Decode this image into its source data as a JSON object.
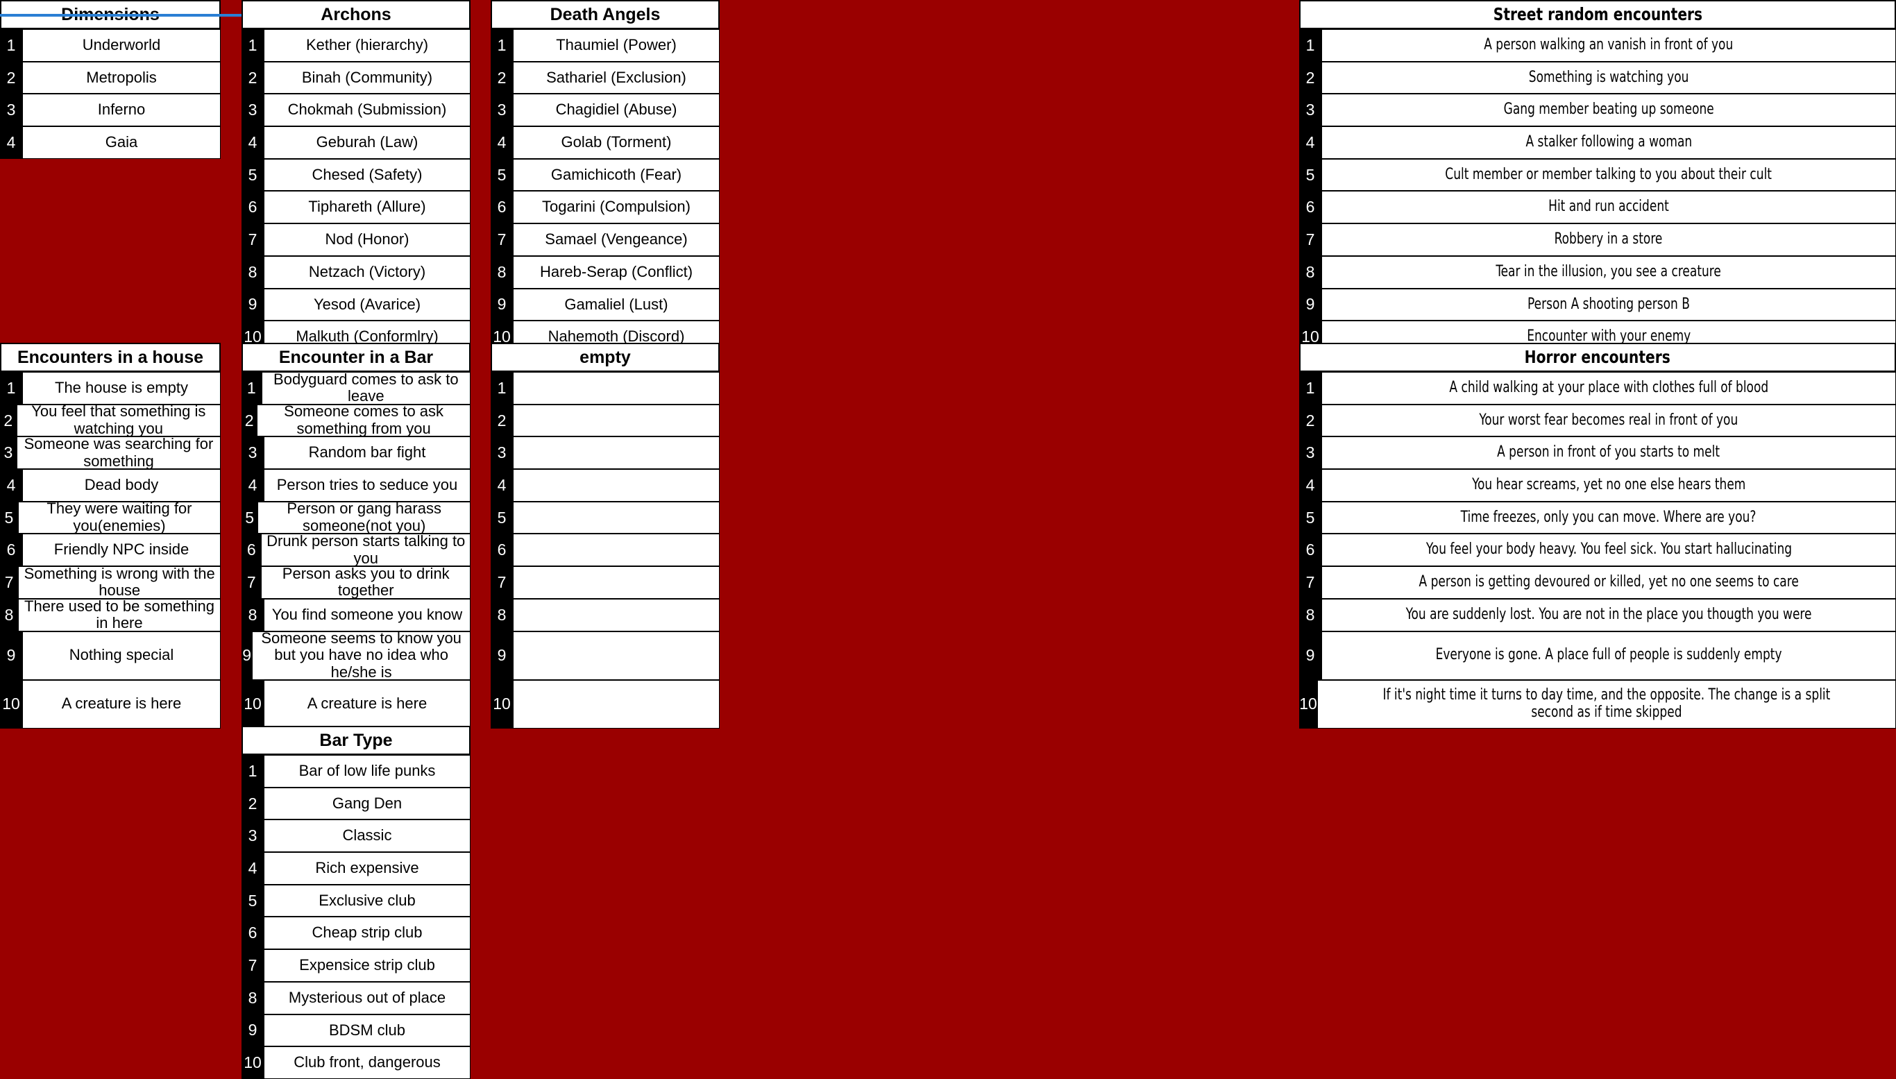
{
  "background_color": "#9a0000",
  "tables": [
    {
      "key": "dimensions",
      "title": "Dimensions",
      "indices": [
        "1",
        "2",
        "3",
        "4"
      ],
      "items": [
        "Underworld",
        "Metropolis",
        "Inferno",
        "Gaia"
      ]
    },
    {
      "key": "archons",
      "title": "Archons",
      "indices": [
        "1",
        "2",
        "3",
        "4",
        "5",
        "6",
        "7",
        "8",
        "9",
        "10"
      ],
      "items": [
        "Kether (hierarchy)",
        "Binah (Community)",
        "Chokmah (Submission)",
        "Geburah (Law)",
        "Chesed (Safety)",
        "Tiphareth (Allure)",
        "Nod (Honor)",
        "Netzach (Victory)",
        "Yesod (Avarice)",
        "Malkuth (Conformlry)"
      ]
    },
    {
      "key": "death_angels",
      "title": "Death Angels",
      "indices": [
        "1",
        "2",
        "3",
        "4",
        "5",
        "6",
        "7",
        "8",
        "9",
        "10"
      ],
      "items": [
        "Thaumiel (Power)",
        "Sathariel (Exclusion)",
        "Chagidiel (Abuse)",
        "Golab (Torment)",
        "Gamichicoth (Fear)",
        "Togarini (Compulsion)",
        "Samael (Vengeance)",
        "Hareb-Serap (Conflict)",
        "Gamaliel (Lust)",
        "Nahemoth (Discord)"
      ]
    },
    {
      "key": "street_random_encounters",
      "title": "Street random encounters",
      "indices": [
        "1",
        "2",
        "3",
        "4",
        "5",
        "6",
        "7",
        "8",
        "9",
        "10"
      ],
      "items": [
        "A person walking an vanish in front of you",
        "Something is watching you",
        "Gang member beating up someone",
        "A stalker following a woman",
        "Cult member or member talking to you about their cult",
        "Hit and run accident",
        "Robbery in a store",
        "Tear in the illusion, you see a creature",
        "Person A shooting person B",
        "Encounter with your enemy"
      ]
    },
    {
      "key": "encounters_in_a_house",
      "title": "Encounters in a house",
      "indices": [
        "1",
        "2",
        "3",
        "4",
        "5",
        "6",
        "7",
        "8",
        "9",
        "10"
      ],
      "items": [
        "The house is empty",
        "You feel that something is watching you",
        "Someone was searching for something",
        "Dead body",
        "They were waiting for you(enemies)",
        "Friendly NPC inside",
        "Something is wrong with the house",
        "There used to be something in here",
        "Nothing special",
        "A creature is here"
      ]
    },
    {
      "key": "encounter_in_a_bar",
      "title": "Encounter in a Bar",
      "indices": [
        "1",
        "2",
        "3",
        "4",
        "5",
        "6",
        "7",
        "8",
        "9",
        "10"
      ],
      "items": [
        "Bodyguard comes to ask to leave",
        "Someone comes to ask something from you",
        "Random bar fight",
        "Person tries to seduce you",
        "Person or gang harass someone(not you)",
        "Drunk person starts talking to you",
        "Person asks you to drink together",
        "You find someone you know",
        "Someone seems to know you but you have no idea who he/she is",
        "A creature is here"
      ]
    },
    {
      "key": "empty",
      "title": "empty",
      "indices": [
        "1",
        "2",
        "3",
        "4",
        "5",
        "6",
        "7",
        "8",
        "9",
        "10"
      ],
      "items": [
        "",
        "",
        "",
        "",
        "",
        "",
        "",
        "",
        "",
        ""
      ]
    },
    {
      "key": "horror_encounters",
      "title": "Horror encounters",
      "indices": [
        "1",
        "2",
        "3",
        "4",
        "5",
        "6",
        "7",
        "8",
        "9",
        "10"
      ],
      "items": [
        "A child walking at your place with clothes full of blood",
        "Your worst fear becomes real in front of you",
        "A person in front of you starts to melt",
        "You hear screams, yet no one else hears them",
        "Time freezes, only you can move. Where are you?",
        "You feel your body heavy. You feel sick. You start hallucinating",
        "A person is getting devoured or killed, yet no one seems to care",
        "You are suddenly lost. You are not in the place you thougth you were",
        "Everyone is gone. A place full of people is suddenly empty",
        "If it's night time it turns to day time, and the opposite. The change is a split second as if time skipped"
      ]
    },
    {
      "key": "bar_type",
      "title": "Bar Type",
      "indices": [
        "1",
        "2",
        "3",
        "4",
        "5",
        "6",
        "7",
        "8",
        "9",
        "10"
      ],
      "items": [
        "Bar of low life punks",
        "Gang Den",
        "Classic",
        "Rich expensive",
        "Exclusive club",
        "Cheap strip club",
        "Expensice strip club",
        "Mysterious out of place",
        "BDSM club",
        "Club front, dangerous"
      ]
    }
  ],
  "selection": {
    "accent_color": "#2a7fd4",
    "target_table": "dimensions"
  }
}
